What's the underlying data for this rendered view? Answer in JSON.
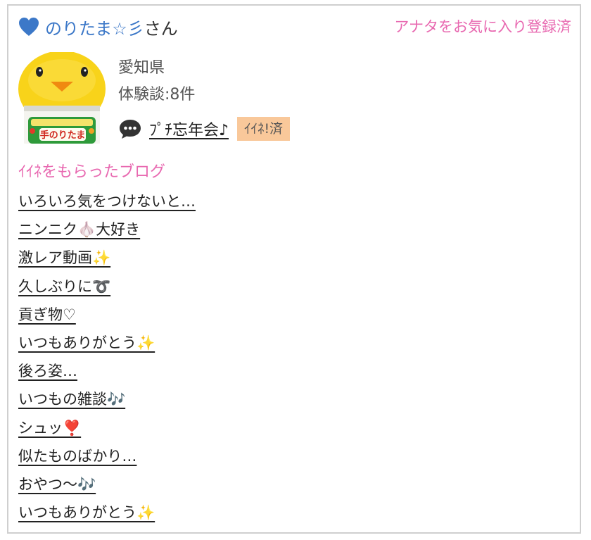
{
  "header": {
    "heart_icon": "blue-heart-icon",
    "user_name": "のりたま☆彡",
    "user_suffix": "さん",
    "favorite_status": "アナタをお気に入り登録済"
  },
  "profile": {
    "image_label": "手のりたま",
    "prefecture": "愛知県",
    "experience_count": "体験談:8件"
  },
  "latest_post": {
    "icon": "speech-bubble-icon",
    "title": "ﾌﾟﾁ忘年会♪",
    "iine_status": "ｲｲﾈ!済"
  },
  "liked_blogs": {
    "title": "ｲｲﾈをもらったブログ",
    "items": [
      "いろいろ気をつけないと…",
      "ニンニク🧄大好き",
      "激レア動画✨",
      "久しぶりに➰",
      "貢ぎ物♡",
      "いつもありがとう✨",
      "後ろ姿…",
      "いつもの雑談🎶",
      "シュッ❣️",
      "似たものばかり…",
      "おやつ〜🎶",
      "いつもありがとう✨"
    ]
  },
  "colors": {
    "name_blue": "#3c78c8",
    "accent_pink": "#e868b0",
    "badge_orange": "#f9c89a",
    "border_gray": "#cfcfcf"
  }
}
